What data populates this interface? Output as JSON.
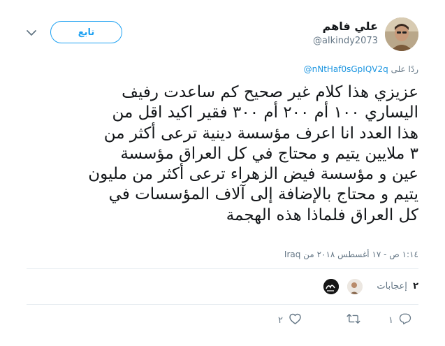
{
  "author": {
    "name": "علي فاهم",
    "handle": "@alkindy2073"
  },
  "follow_label": "تابع",
  "reply_context": {
    "prefix": "ردًا على",
    "handle": "@nNtHaf0sGpIQV2q"
  },
  "tweet_text": "عزيزي هذا كلام غير صحيح كم ساعدت رفيف\nاليساري ١٠٠ أم ٢٠٠ أم ٣٠٠ فقير اكيد اقل من\nهذا العدد انا اعرف مؤسسة دينية ترعى أكثر من\n٣ ملايين يتيم و محتاج في كل العراق مؤسسة\nعين و مؤسسة فيض الزهراء ترعى أكثر من مليون\nيتيم و محتاج بالإضافة إلى آلاف المؤسسات في\nكل العراق فلماذا هذه الهجمة",
  "timestamp": "١:١٤ ص - ١٧ أغسطس ٢٠١٨ من Iraq",
  "stats": {
    "likes_count": "٢",
    "likes_label": "إعجابات"
  },
  "actions": {
    "reply_count": "١",
    "retweet_count": "",
    "like_count": "٢"
  },
  "icons": {
    "chevron": "chevron-down-icon",
    "reply": "reply-icon",
    "retweet": "retweet-icon",
    "like": "heart-icon"
  },
  "colors": {
    "accent": "#1da1f2",
    "link": "#1b95e0",
    "muted": "#657786",
    "text": "#14171a",
    "divider": "#e6ecf0"
  }
}
